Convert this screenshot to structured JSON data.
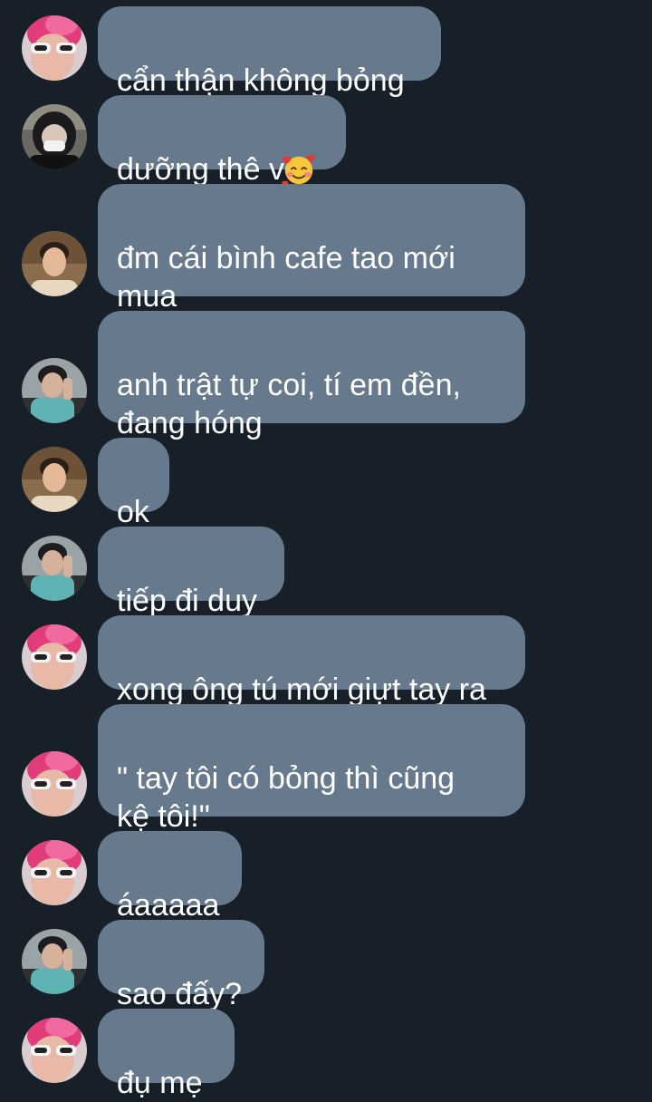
{
  "messages": [
    {
      "sender": "pink-hair",
      "text": "cẩn thận không bỏng"
    },
    {
      "sender": "masked",
      "text": "dưỡng thê v",
      "emoji": "smiling-face-with-hearts-emoji"
    },
    {
      "sender": "beige-shirt",
      "text": "đm cái bình cafe tao mới\nmua"
    },
    {
      "sender": "teal-shirt",
      "text": "anh trật tự coi, tí em đền,\nđang hóng"
    },
    {
      "sender": "beige-shirt",
      "text": "ok"
    },
    {
      "sender": "teal-shirt",
      "text": "tiếp đi duy"
    },
    {
      "sender": "pink-hair",
      "text": "xong ông tú mới giựt tay ra"
    },
    {
      "sender": "pink-hair",
      "text": "\" tay tôi có bỏng thì cũng\nkệ tôi!\""
    },
    {
      "sender": "pink-hair",
      "text": "áaaaaa"
    },
    {
      "sender": "teal-shirt",
      "text": "sao đấy?"
    },
    {
      "sender": "pink-hair",
      "text": "đụ mẹ"
    }
  ],
  "colors": {
    "background": "#172029",
    "bubble": "#677a8d",
    "text": "#ffffff"
  }
}
